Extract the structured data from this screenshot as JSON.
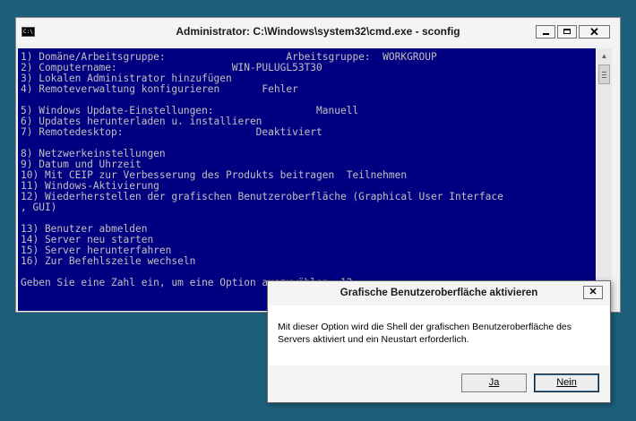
{
  "cmd_window": {
    "title": "Administrator: C:\\Windows\\system32\\cmd.exe - sconfig",
    "icon_label": "C:\\",
    "close_glyph": "✕",
    "console_lines": [
      "1) Domäne/Arbeitsgruppe:                    Arbeitsgruppe:  WORKGROUP",
      "2) Computername:                   WIN-PULUGL53T30",
      "3) Lokalen Administrator hinzufügen",
      "4) Remoteverwaltung konfigurieren       Fehler",
      "",
      "5) Windows Update-Einstellungen:                 Manuell",
      "6) Updates herunterladen u. installieren",
      "7) Remotedesktop:                      Deaktiviert",
      "",
      "8) Netzwerkeinstellungen",
      "9) Datum und Uhrzeit",
      "10) Mit CEIP zur Verbesserung des Produkts beitragen  Teilnehmen",
      "11) Windows-Aktivierung",
      "12) Wiederherstellen der grafischen Benutzeroberfläche (Graphical User Interface",
      ", GUI)",
      "",
      "13) Benutzer abmelden",
      "14) Server neu starten",
      "15) Server herunterfahren",
      "16) Zur Befehlszeile wechseln",
      "",
      "Geben Sie eine Zahl ein, um eine Option auszuwählen: 12"
    ]
  },
  "dialog": {
    "title": "Grafische Benutzeroberfläche aktivieren",
    "close_glyph": "✕",
    "message": "Mit dieser Option wird die Shell der grafischen Benutzeroberfläche des Servers aktiviert und ein Neustart erforderlich.",
    "yes_label": "Ja",
    "no_label": "Nein"
  },
  "colors": {
    "desktop": "#1d5e7a",
    "console_bg": "#000080",
    "console_fg": "#c0c0c0"
  }
}
